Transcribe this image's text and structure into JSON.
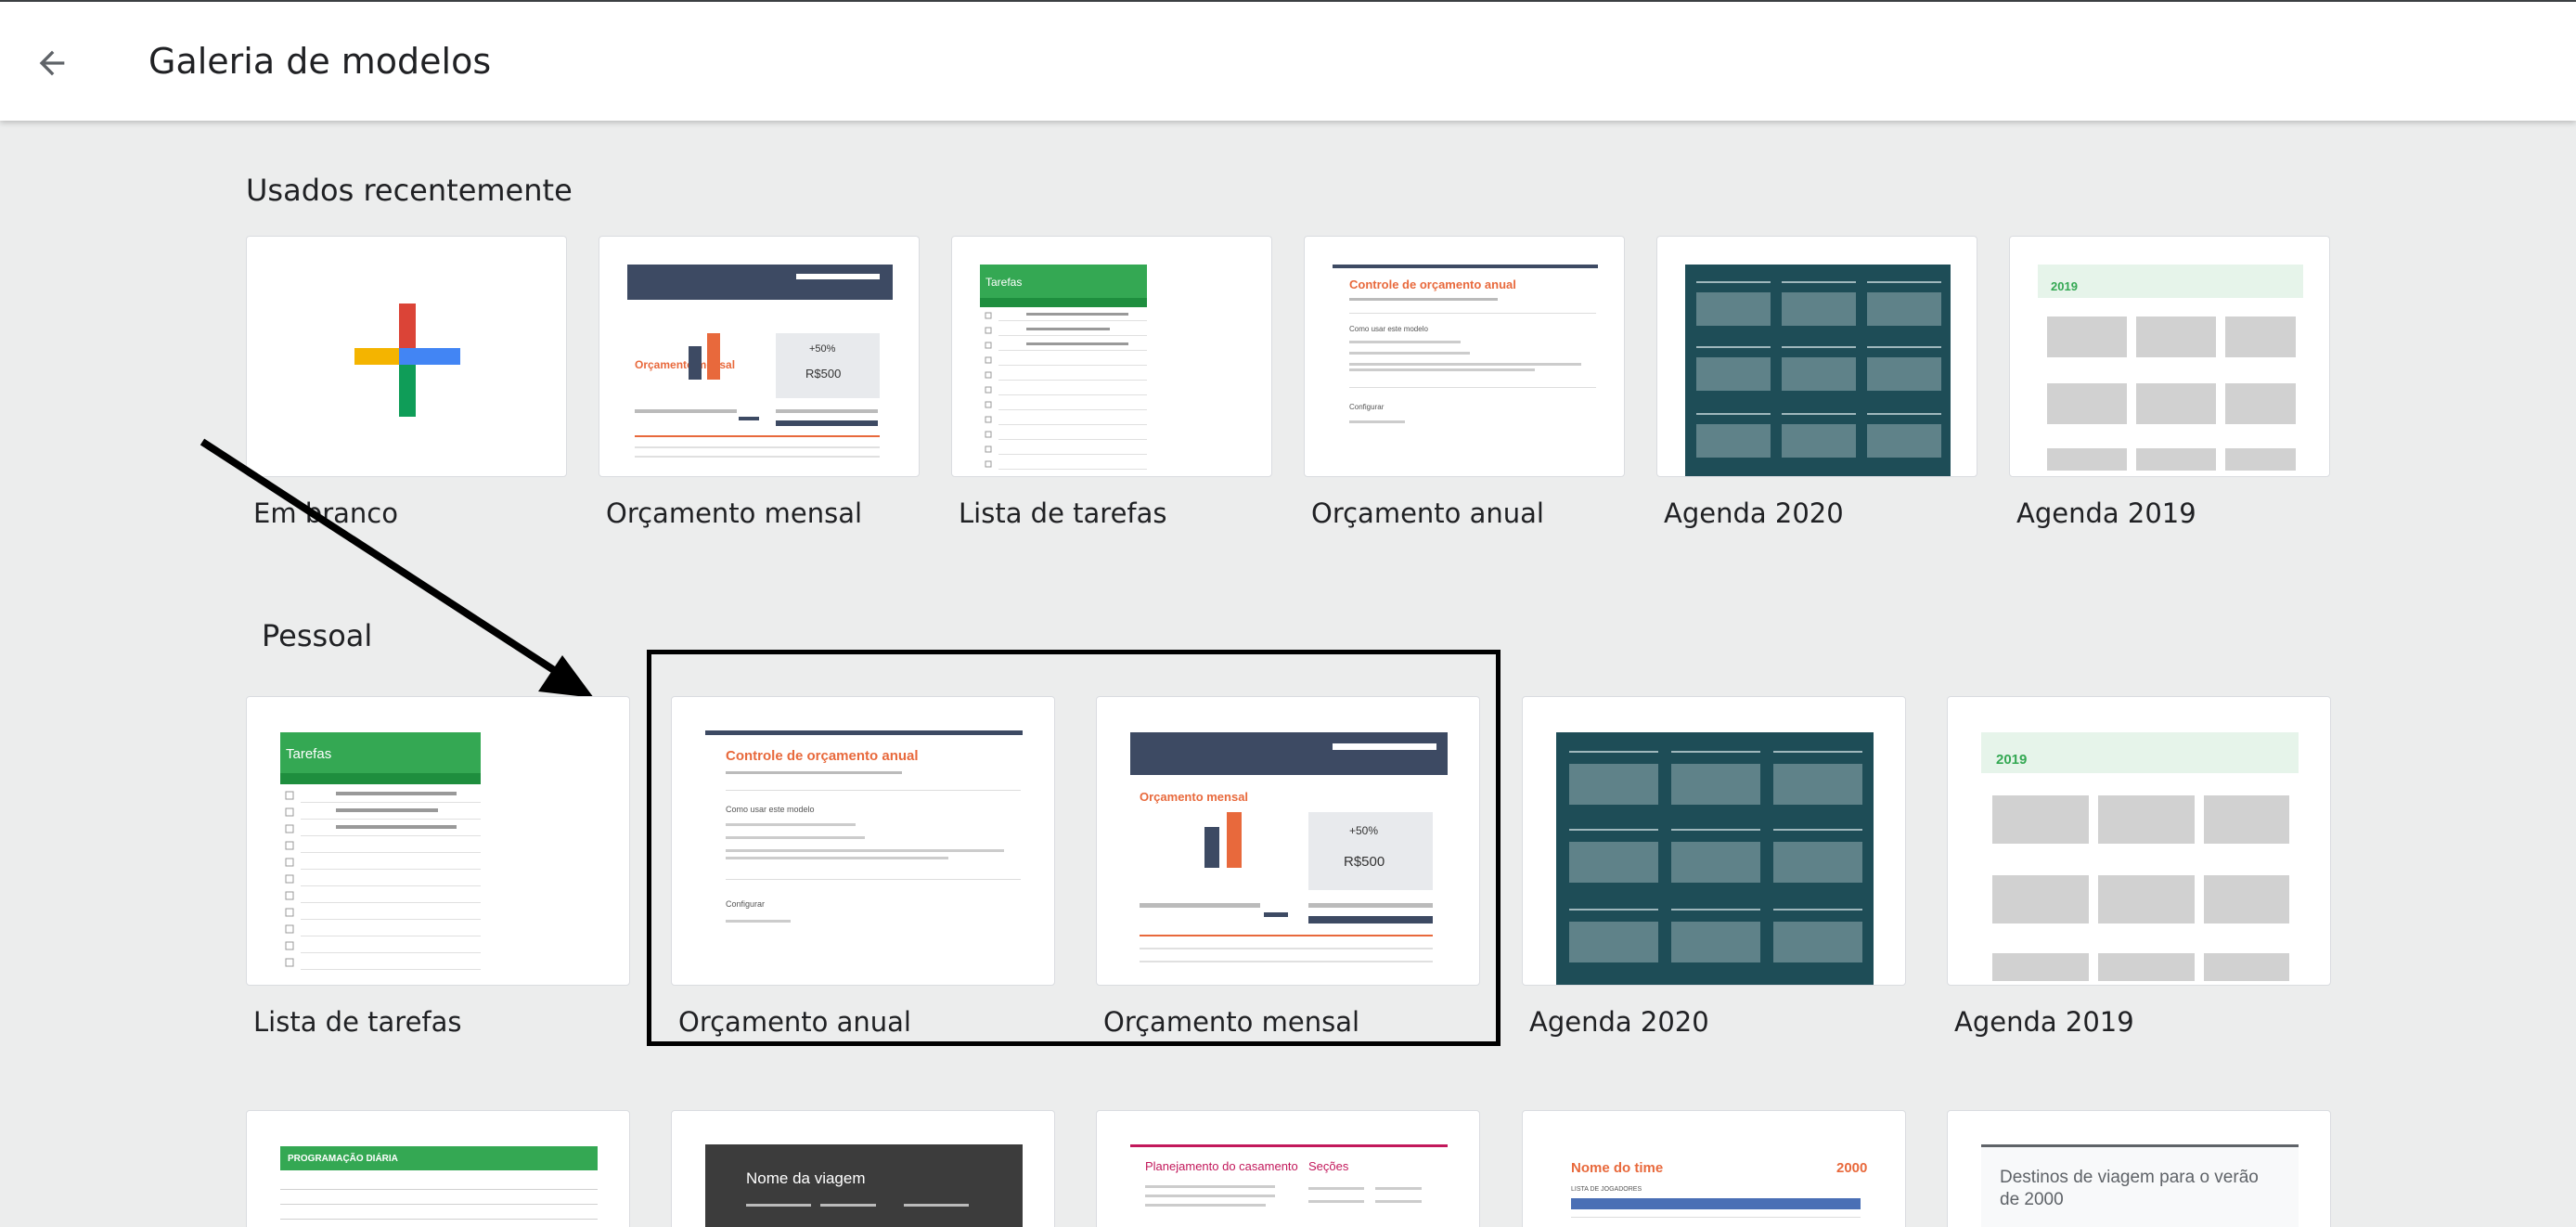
{
  "header": {
    "title": "Galeria de modelos",
    "back_icon": "arrow-back-icon"
  },
  "sections": {
    "recent": {
      "title": "Usados recentemente",
      "cards": [
        {
          "label": "Em branco"
        },
        {
          "label": "Orçamento mensal"
        },
        {
          "label": "Lista de tarefas"
        },
        {
          "label": "Orçamento anual"
        },
        {
          "label": "Agenda 2020"
        },
        {
          "label": "Agenda 2019"
        }
      ]
    },
    "personal": {
      "title": "Pessoal",
      "cards": [
        {
          "label": "Lista de tarefas"
        },
        {
          "label": "Orçamento anual"
        },
        {
          "label": "Orçamento mensal"
        },
        {
          "label": "Agenda 2020"
        },
        {
          "label": "Agenda 2019"
        }
      ]
    },
    "third_row": {
      "cards": [
        {
          "thumb_title": "PROGRAMAÇÃO DIÁRIA"
        },
        {
          "thumb_title": "Nome da viagem"
        },
        {
          "thumb_title": "Planejamento do casamento",
          "thumb_sub": "Seções"
        },
        {
          "thumb_title": "Nome do time",
          "thumb_year": "2000",
          "thumb_sub": "LISTA DE JOGADORES"
        },
        {
          "thumb_title": "Destinos de viagem para o verão de 2000"
        }
      ]
    }
  },
  "thumbs": {
    "tarefas": "Tarefas",
    "budget_annual": "Controle de orçamento anual",
    "budget_annual_how": "Como usar este modelo",
    "budget_annual_config": "Configurar",
    "budget_monthly": "Orçamento mensal",
    "budget_monthly_pct": "+50%",
    "budget_monthly_value": "R$500",
    "calendar_2019": "2019"
  },
  "colors": {
    "plus_red": "#db4437",
    "plus_blue": "#4285f4",
    "plus_yellow": "#f4b400",
    "plus_green": "#0f9d58",
    "calendar_teal": "#1e4d57",
    "sheet_green": "#34a853",
    "budget_orange": "#e8693c",
    "budget_navy": "#3d4a63"
  }
}
